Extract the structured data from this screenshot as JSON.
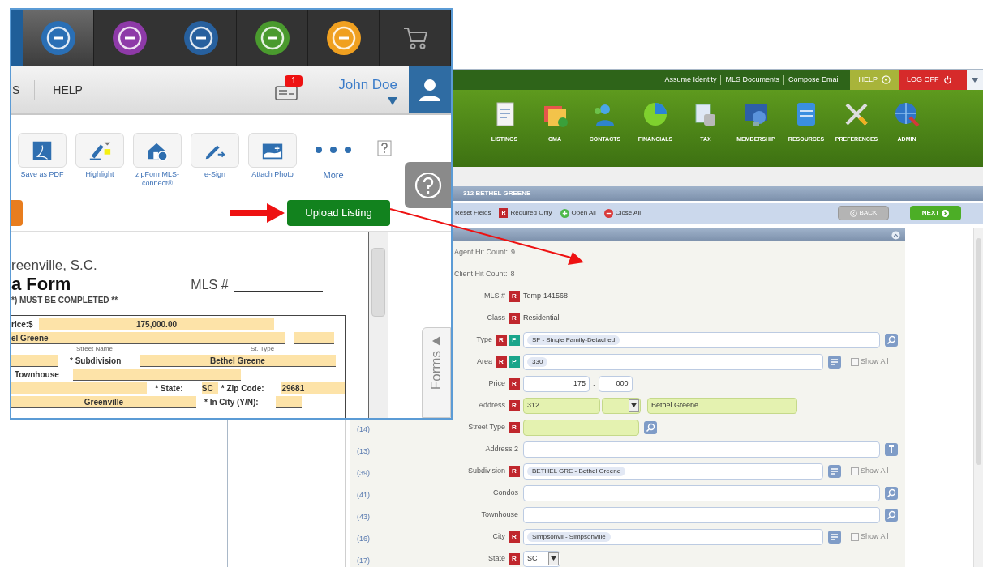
{
  "front_window": {
    "app_tabs": [
      {
        "kind": "circle",
        "color": "#2a6fb5",
        "selected": true
      },
      {
        "kind": "circle",
        "color": "#8e3aa8",
        "selected": false
      },
      {
        "kind": "circle",
        "color": "#27609e",
        "selected": false
      },
      {
        "kind": "circle",
        "color": "#4a9a2e",
        "selected": false
      },
      {
        "kind": "circle",
        "color": "#f0a020",
        "selected": false
      },
      {
        "kind": "cart",
        "selected": false
      }
    ],
    "menu": [
      "S",
      "HELP"
    ],
    "notification_count": "1",
    "user_name": "John Doe",
    "tools": [
      {
        "kind": "pdf",
        "label": "Save as PDF"
      },
      {
        "kind": "highlighter",
        "label": "Highlight"
      },
      {
        "kind": "house",
        "label": "zipFormMLS-connect®"
      },
      {
        "kind": "pen",
        "label": "e-Sign"
      },
      {
        "kind": "photo",
        "label": "Attach Photo"
      },
      {
        "kind": "dots",
        "label": "More"
      }
    ],
    "upload_button": "Upload Listing",
    "document": {
      "city_line": "reenville, S.C.",
      "title": "a Form",
      "mls_label": "MLS #",
      "note": "*) MUST BE COMPLETED **",
      "rows": [
        [
          {
            "kind": "label",
            "text": "rice:$"
          },
          {
            "kind": "field",
            "value": "175,000.00"
          }
        ],
        [
          {
            "kind": "field",
            "value": "el Greene"
          },
          {
            "kind": "field"
          }
        ],
        [
          {
            "kind": "caption",
            "text": "Street Name"
          },
          {
            "kind": "caption",
            "text": "St. Type"
          }
        ],
        [
          {
            "kind": "field"
          },
          {
            "kind": "label",
            "text": "* Subdivision"
          },
          {
            "kind": "field",
            "value": "Bethel Greene"
          }
        ],
        [
          {
            "kind": "label",
            "text": "Townhouse"
          },
          {
            "kind": "field"
          }
        ],
        [
          {
            "kind": "field"
          },
          {
            "kind": "label",
            "text": "* State:"
          },
          {
            "kind": "field",
            "value": "SC"
          },
          {
            "kind": "label",
            "text": "* Zip Code:"
          },
          {
            "kind": "field",
            "value": "29681"
          }
        ],
        [
          {
            "kind": "field",
            "value": "Greenville"
          },
          {
            "kind": "label",
            "text": "* In City (Y/N):"
          },
          {
            "kind": "field"
          }
        ]
      ]
    },
    "forms_tab": "Forms"
  },
  "back_window": {
    "top_links": [
      "Assume Identity",
      "MLS Documents",
      "Compose Email"
    ],
    "help_button": "HELP",
    "logoff_button": "LOG OFF",
    "nav": [
      {
        "kind": "document",
        "label": "LISTINGS"
      },
      {
        "kind": "folders",
        "label": "CMA"
      },
      {
        "kind": "people",
        "label": "CONTACTS"
      },
      {
        "kind": "pie",
        "label": "FINANCIALS"
      },
      {
        "kind": "files",
        "label": "TAX"
      },
      {
        "kind": "monitor",
        "label": "MEMBERSHIP"
      },
      {
        "kind": "server",
        "label": "RESOURCES"
      },
      {
        "kind": "tools",
        "label": "PREFERENCES"
      },
      {
        "kind": "globe",
        "label": "ADMIN"
      }
    ],
    "record_title": "- 312 BETHEL GREENE",
    "toolbar": [
      {
        "kind": "reset",
        "label": "Reset Fields"
      },
      {
        "kind": "required",
        "label": "Required Only",
        "badge": "R"
      },
      {
        "kind": "open",
        "label": "Open All"
      },
      {
        "kind": "close",
        "label": "Close All"
      }
    ],
    "back_button": "BACK",
    "next_button": "NEXT",
    "rows": [
      {
        "kind": "count",
        "label": "Agent Hit Count:",
        "value": "9"
      },
      {
        "kind": "count",
        "label": "Client Hit Count:",
        "value": "8"
      },
      {
        "kind": "static",
        "label": "MLS #",
        "badges": [
          {
            "label": "R",
            "color": "#c0272d"
          }
        ],
        "value": "Temp-141568"
      },
      {
        "kind": "static",
        "label": "Class",
        "badges": [
          {
            "label": "R",
            "color": "#c0272d"
          }
        ],
        "value": "Residential"
      },
      {
        "kind": "lookup",
        "label": "Type",
        "badges": [
          {
            "label": "R",
            "color": "#c0272d"
          },
          {
            "label": "P",
            "color": "#1aa58a"
          }
        ],
        "chip": "SF - Single Family-Detached",
        "button": {
          "kind": "search"
        },
        "highlighted": false
      },
      {
        "kind": "lookup",
        "label": "Area",
        "badges": [
          {
            "label": "R",
            "color": "#c0272d"
          },
          {
            "label": "P",
            "color": "#1aa58a"
          }
        ],
        "chip": "330",
        "button": {
          "kind": "list"
        },
        "highlighted": false,
        "show_all": {
          "label": "Show All",
          "checked": false
        }
      },
      {
        "kind": "price",
        "label": "Price",
        "badges": [
          {
            "label": "R",
            "color": "#c0272d"
          }
        ],
        "values": [
          "175",
          "000"
        ],
        "separator": "."
      },
      {
        "kind": "address",
        "label": "Address",
        "badges": [
          {
            "label": "R",
            "color": "#c0272d"
          }
        ],
        "number": "312",
        "street": "Bethel Greene",
        "highlighted": true
      },
      {
        "kind": "short_lookup",
        "number": "(14)",
        "label": "Street Type",
        "badges": [
          {
            "label": "R",
            "color": "#c0272d"
          }
        ],
        "button": {
          "kind": "search"
        },
        "highlighted": true
      },
      {
        "kind": "lookup",
        "number": "(13)",
        "label": "Address 2",
        "button": {
          "kind": "info"
        },
        "highlighted": false
      },
      {
        "kind": "lookup",
        "number": "(39)",
        "label": "Subdivision",
        "badges": [
          {
            "label": "R",
            "color": "#c0272d"
          }
        ],
        "chip": "BETHEL GRE - Bethel Greene",
        "button": {
          "kind": "list"
        },
        "highlighted": false,
        "show_all": {
          "label": "Show All",
          "checked": false
        }
      },
      {
        "kind": "lookup",
        "number": "(41)",
        "label": "Condos",
        "button": {
          "kind": "search"
        },
        "highlighted": false
      },
      {
        "kind": "lookup",
        "number": "(43)",
        "label": "Townhouse",
        "button": {
          "kind": "search"
        },
        "highlighted": false
      },
      {
        "kind": "lookup",
        "number": "(16)",
        "label": "City",
        "badges": [
          {
            "label": "R",
            "color": "#c0272d"
          }
        ],
        "chip": "Simpsonvil - Simpsonville",
        "button": {
          "kind": "list"
        },
        "highlighted": false,
        "show_all": {
          "label": "Show All",
          "checked": false
        }
      },
      {
        "kind": "select",
        "number": "(17)",
        "label": "State",
        "badges": [
          {
            "label": "R",
            "color": "#c0272d"
          }
        ],
        "value": "SC"
      }
    ]
  }
}
